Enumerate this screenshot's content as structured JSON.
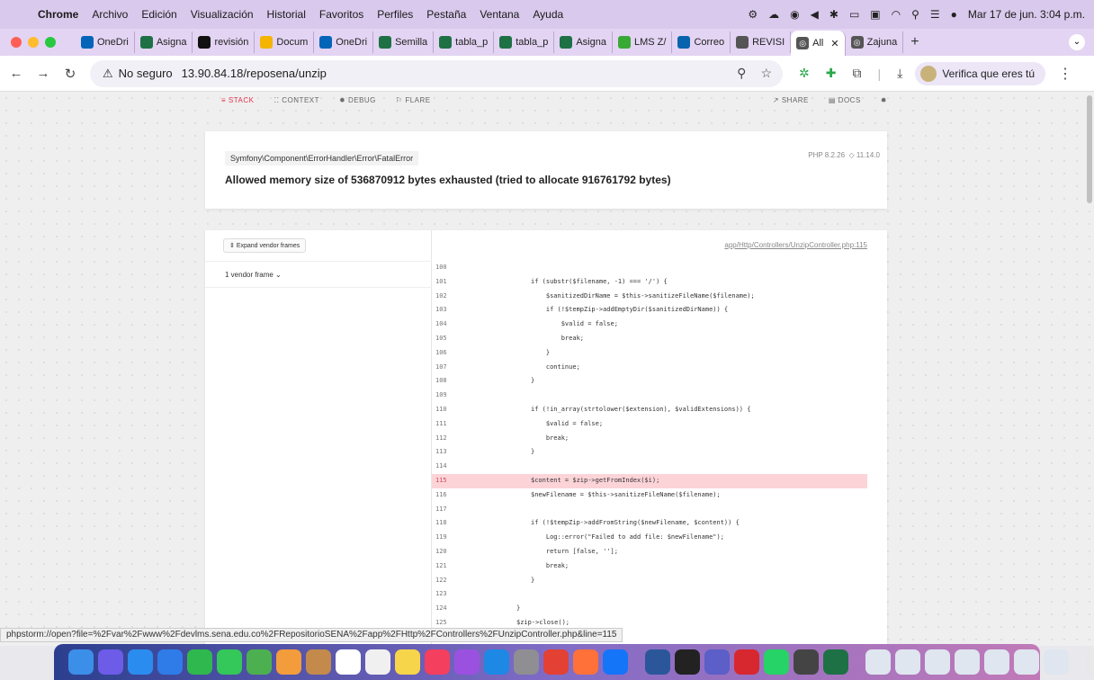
{
  "menubar": {
    "app": "Chrome",
    "items": [
      "Archivo",
      "Edición",
      "Visualización",
      "Historial",
      "Favoritos",
      "Perfiles",
      "Pestaña",
      "Ventana",
      "Ayuda"
    ],
    "clock": "Mar 17 de jun. 3:04 p.m."
  },
  "tabs": [
    {
      "label": "OneDri",
      "icon": "onedrive-icon",
      "color": "#0364b8"
    },
    {
      "label": "Asigna",
      "icon": "excel-icon",
      "color": "#1e7145"
    },
    {
      "label": "revisión",
      "icon": "threads-icon",
      "color": "#111111"
    },
    {
      "label": "Docum",
      "icon": "google-drive-icon",
      "color": "#f4b400"
    },
    {
      "label": "OneDri",
      "icon": "onedrive-icon",
      "color": "#0364b8"
    },
    {
      "label": "Semilla",
      "icon": "excel-icon",
      "color": "#1e7145"
    },
    {
      "label": "tabla_p",
      "icon": "excel-icon",
      "color": "#1e7145"
    },
    {
      "label": "tabla_p",
      "icon": "excel-icon",
      "color": "#1e7145"
    },
    {
      "label": "Asigna",
      "icon": "excel-icon",
      "color": "#1e7145"
    },
    {
      "label": "LMS Z/",
      "icon": "lms-icon",
      "color": "#39a935"
    },
    {
      "label": "Correo",
      "icon": "outlook-icon",
      "color": "#0a64ad"
    },
    {
      "label": "REVISI",
      "icon": "globe-icon",
      "color": "#555555"
    }
  ],
  "active_tab": {
    "label": "All",
    "icon": "globe-icon"
  },
  "extra_tab": {
    "label": "Zajuna",
    "icon": "globe-icon"
  },
  "toolbar": {
    "security": "No seguro",
    "url": "13.90.84.18/reposena/unzip",
    "verify_label": "Verifica que eres tú"
  },
  "flare": {
    "nav": [
      "STACK",
      "CONTEXT",
      "DEBUG",
      "FLARE"
    ],
    "nav_right": [
      "SHARE",
      "DOCS"
    ],
    "exception_class": "Symfony\\Component\\ErrorHandler\\Error\\FatalError",
    "message": "Allowed memory size of 536870912 bytes exhausted (tried to allocate 916761792 bytes)",
    "php_version": "PHP 8.2.26",
    "laravel_version": "11.14.0",
    "expand_vendor": "Expand vendor frames",
    "vendor_frames": "1 vendor frame",
    "file_path": "app/Http/Controllers/UnzipController.php:115",
    "highlight_line": 115,
    "code_lines": [
      {
        "n": "100",
        "code": ""
      },
      {
        "n": "101",
        "code": "if (substr($filename, -1) === '/') {"
      },
      {
        "n": "102",
        "code": "    $sanitizedDirName = $this->sanitizeFileName($filename);"
      },
      {
        "n": "103",
        "code": "    if (!$tempZip->addEmptyDir($sanitizedDirName)) {"
      },
      {
        "n": "104",
        "code": "        $valid = false;"
      },
      {
        "n": "105",
        "code": "        break;"
      },
      {
        "n": "106",
        "code": "    }"
      },
      {
        "n": "107",
        "code": "    continue;"
      },
      {
        "n": "108",
        "code": "}"
      },
      {
        "n": "109",
        "code": ""
      },
      {
        "n": "110",
        "code": "if (!in_array(strtolower($extension), $validExtensions)) {"
      },
      {
        "n": "111",
        "code": "    $valid = false;"
      },
      {
        "n": "112",
        "code": "    break;"
      },
      {
        "n": "113",
        "code": "}"
      },
      {
        "n": "114",
        "code": ""
      },
      {
        "n": "115",
        "code": "$content = $zip->getFromIndex($i);"
      },
      {
        "n": "116",
        "code": "$newFilename = $this->sanitizeFileName($filename);"
      },
      {
        "n": "117",
        "code": ""
      },
      {
        "n": "118",
        "code": "if (!$tempZip->addFromString($newFilename, $content)) {"
      },
      {
        "n": "119",
        "code": "    Log::error(\"Failed to add file: $newFilename\");"
      },
      {
        "n": "120",
        "code": "    return [false, ''];"
      },
      {
        "n": "121",
        "code": "    break;"
      },
      {
        "n": "122",
        "code": "}"
      },
      {
        "n": "123",
        "code": ""
      },
      {
        "n": "124",
        "code": "}",
        "indent": -2
      },
      {
        "n": "125",
        "code": "$zip->close();",
        "indent": -2
      }
    ]
  },
  "status_url": "phpstorm://open?file=%2Fvar%2Fwww%2Fdevlms.sena.edu.co%2FRepositorioSENA%2Fapp%2FHttp%2FControllers%2FUnzipController.php&line=115",
  "dock": [
    {
      "name": "finder-icon",
      "color": "#3b8fe8"
    },
    {
      "name": "launchpad-icon",
      "color": "#6c5ce7"
    },
    {
      "name": "safari-icon",
      "color": "#2b8cf0"
    },
    {
      "name": "mail-icon",
      "color": "#2f7ce9"
    },
    {
      "name": "facetime-icon",
      "color": "#2fb84e"
    },
    {
      "name": "messages-icon",
      "color": "#34c759"
    },
    {
      "name": "maps-icon",
      "color": "#4cb050"
    },
    {
      "name": "photos-icon",
      "color": "#f39c3c"
    },
    {
      "name": "contacts-icon",
      "color": "#c38a4c"
    },
    {
      "name": "calendar-icon",
      "color": "#ffffff"
    },
    {
      "name": "reminders-icon",
      "color": "#f0f0f0"
    },
    {
      "name": "notes-icon",
      "color": "#f7d54a"
    },
    {
      "name": "music-icon",
      "color": "#f43f5e"
    },
    {
      "name": "podcasts-icon",
      "color": "#9b51e0"
    },
    {
      "name": "app-store-icon",
      "color": "#1e88e5"
    },
    {
      "name": "settings-icon",
      "color": "#8e8e93"
    },
    {
      "name": "chrome-icon",
      "color": "#e34133"
    },
    {
      "name": "firefox-icon",
      "color": "#ff7139"
    },
    {
      "name": "xcode-icon",
      "color": "#1575f9"
    },
    {
      "name": "word-icon",
      "color": "#2b579a"
    },
    {
      "name": "terminal-icon",
      "color": "#222222"
    },
    {
      "name": "teams-icon",
      "color": "#5b5fc7"
    },
    {
      "name": "acrobat-icon",
      "color": "#d7282f"
    },
    {
      "name": "whatsapp-icon",
      "color": "#25d366"
    },
    {
      "name": "calculator-icon",
      "color": "#444444"
    },
    {
      "name": "excel-icon",
      "color": "#1e7145"
    },
    {
      "name": "window-thumb-1",
      "color": "#dfe6ef"
    },
    {
      "name": "window-thumb-2",
      "color": "#dfe6ef"
    },
    {
      "name": "window-thumb-3",
      "color": "#dfe6ef"
    },
    {
      "name": "window-thumb-4",
      "color": "#dfe6ef"
    },
    {
      "name": "window-thumb-5",
      "color": "#dfe6ef"
    },
    {
      "name": "window-thumb-6",
      "color": "#dfe6ef"
    },
    {
      "name": "window-thumb-7",
      "color": "#dfe6ef"
    },
    {
      "name": "trash-icon",
      "color": "#e8e8e8"
    }
  ]
}
